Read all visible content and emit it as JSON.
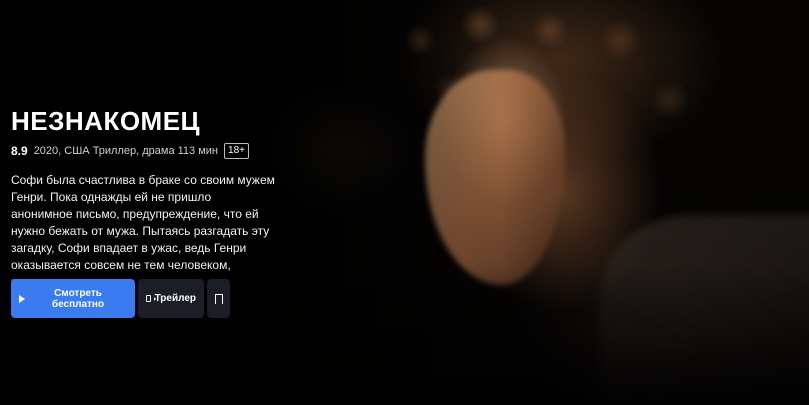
{
  "movie": {
    "title": "НЕЗНАКОМЕЦ",
    "rating": "8.9",
    "meta": "2020, США Триллер, драма 113 мин",
    "age_rating": "18+",
    "description": "Софи была счастлива в браке со своим мужем Генри. Пока однажды ей не пришло анонимное письмо, предупреждение, что ей нужно бежать от мужа. Пытаясь разгадать эту загадку, Софи впадает в ужас, ведь Генри оказывается совсем не тем человеком, которого она знает…"
  },
  "actions": {
    "watch_label": "Смотреть бесплатно",
    "trailer_label": "Трейлер"
  },
  "icons": {
    "watch": "play-icon",
    "trailer": "trailer-icon",
    "favorite": "bookmark-icon"
  },
  "colors": {
    "accent": "#3a7cf0",
    "secondary_button": "#1b1e26",
    "background": "#000000"
  }
}
